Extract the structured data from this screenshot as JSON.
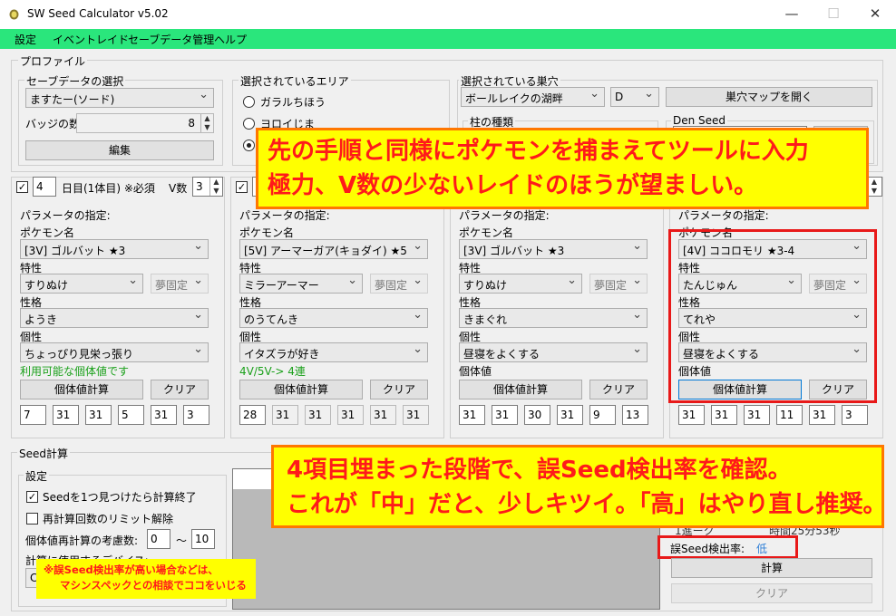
{
  "window": {
    "title": "SW Seed Calculator v5.02",
    "minimize": "—",
    "maximize": "☐",
    "close": "✕"
  },
  "menu": [
    "設定",
    "イベントレイド",
    "セーブデータ管理",
    "ヘルプ"
  ],
  "profile": {
    "title": "プロファイル",
    "save_group": "セーブデータの選択",
    "save_value": "ますたー(ソード)",
    "badge_label": "バッジの数",
    "badge_value": "8",
    "edit_button": "編集"
  },
  "area": {
    "title": "選択されているエリア",
    "options": [
      "ガラルちほう",
      "ヨロイじま",
      ""
    ],
    "selected_index": 2
  },
  "den": {
    "title": "選択されている巣穴",
    "den_value": "ボールレイクの湖畔",
    "rank_value": "D",
    "map_button": "巣穴マップを開く",
    "pillar_label": "柱の種類",
    "seed_label": "Den Seed"
  },
  "slots": [
    {
      "day_value": "4",
      "day_label": "日目(1体目) ※必須",
      "v_label": "V数",
      "v_value": "3",
      "param_label": "パラメータの指定:",
      "pokemon_label": "ポケモン名",
      "pokemon": "[3V] ゴルバット ★3",
      "ability_label": "特性",
      "ability": "すりぬけ",
      "hidden": "夢固定",
      "nature_label": "性格",
      "nature": "ようき",
      "char_label": "個性",
      "characteristic": "ちょっぴり見栄っ張り",
      "note": "利用可能な個体値です",
      "calc_button": "個体値計算",
      "clear_button": "クリア",
      "ivs": [
        "7",
        "31",
        "31",
        "5",
        "31",
        "3"
      ]
    },
    {
      "day_value": "",
      "day_label": "",
      "v_label": "",
      "v_value": "",
      "param_label": "パラメータの指定:",
      "pokemon_label": "ポケモン名",
      "pokemon": "[5V] アーマーガア(キョダイ) ★5",
      "ability_label": "特性",
      "ability": "ミラーアーマー",
      "hidden": "夢固定",
      "nature_label": "性格",
      "nature": "のうてんき",
      "char_label": "個性",
      "characteristic": "イタズラが好き",
      "note": "4V/5V-> 4連",
      "calc_button": "個体値計算",
      "clear_button": "クリア",
      "ivs": [
        "28",
        "31",
        "31",
        "31",
        "31",
        "31"
      ]
    },
    {
      "day_value": "",
      "day_label": "",
      "v_label": "",
      "v_value": "",
      "param_label": "パラメータの指定:",
      "pokemon_label": "ポケモン名",
      "pokemon": "[3V] ゴルバット ★3",
      "ability_label": "特性",
      "ability": "すりぬけ",
      "hidden": "夢固定",
      "nature_label": "性格",
      "nature": "きまぐれ",
      "char_label": "個性",
      "characteristic": "昼寝をよくする",
      "iv_label": "個体値",
      "calc_button": "個体値計算",
      "clear_button": "クリア",
      "ivs": [
        "31",
        "31",
        "30",
        "31",
        "9",
        "13"
      ]
    },
    {
      "day_value": "",
      "day_label": "",
      "v_label": "",
      "v_value": "",
      "param_label": "パラメータの指定:",
      "pokemon_label": "ポケモン名",
      "pokemon": "[4V] ココロモリ ★3-4",
      "ability_label": "特性",
      "ability": "たんじゅん",
      "hidden": "夢固定",
      "nature_label": "性格",
      "nature": "てれや",
      "char_label": "個性",
      "characteristic": "昼寝をよくする",
      "iv_label": "個体値",
      "calc_button": "個体値計算",
      "clear_button": "クリア",
      "ivs": [
        "31",
        "31",
        "31",
        "11",
        "31",
        "3"
      ]
    }
  ],
  "seed": {
    "title": "Seed計算",
    "settings_title": "設定",
    "stop_on_find": "Seedを1つ見つけたら計算終了",
    "stop_on_find_checked": true,
    "unlimit": "再計算回数のリミット解除",
    "unlimit_checked": false,
    "reroll_label": "個体値再計算の考慮数:",
    "reroll_from": "0",
    "reroll_tilde": "～",
    "reroll_to": "10",
    "device_label": "計算に使用するデバイス:",
    "device_value": "C",
    "progress_partial": "1進ーク",
    "time_partial": "時間25分53秒",
    "false_rate_label": "誤Seed検出率:",
    "false_rate_value": "低",
    "calc_button": "計算",
    "clear_button": "クリア"
  },
  "annotations": {
    "top_line1": "先の手順と同様にポケモンを捕まえてツールに入力",
    "top_line2": "極力、V数の少ないレイドのほうが望ましい。",
    "mid_line1": "4項目埋まった段階で、誤Seed検出率を確認。",
    "mid_line2": "これが「中」だと、少しキツイ。「高」はやり直し推奨。",
    "note_line1": "※誤Seed検出率が高い場合などは、",
    "note_line2": "マシンスペックとの相談でココをいじる"
  },
  "colors": {
    "menubar": "#2ae67c",
    "annotation_bg": "#ffff00",
    "annotation_text": "#ff1a1a",
    "highlight_frame": "#e81919",
    "valid_note": "#1aa01a",
    "rate_low": "#2f7fd6"
  }
}
